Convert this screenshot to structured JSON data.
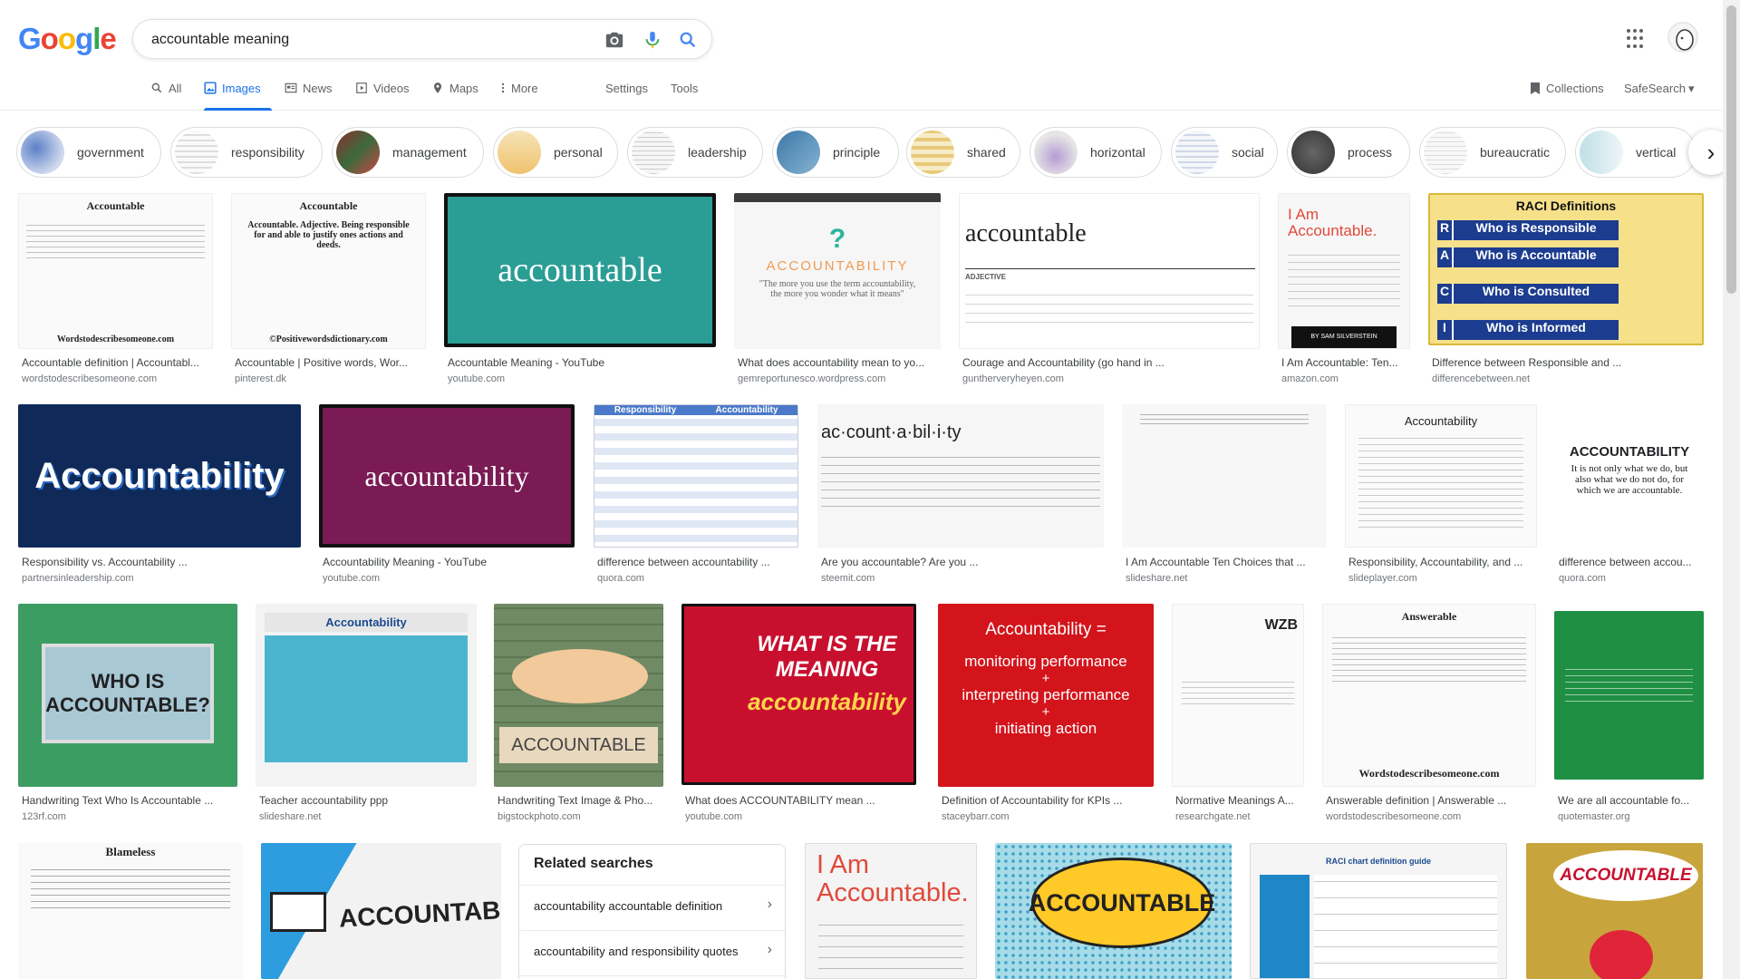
{
  "logo": [
    "G",
    "o",
    "o",
    "g",
    "l",
    "e"
  ],
  "search": {
    "value": "accountable meaning"
  },
  "tabs": [
    {
      "label": "All",
      "icon": "search-icon"
    },
    {
      "label": "Images",
      "icon": "image-icon"
    },
    {
      "label": "News",
      "icon": "news-icon"
    },
    {
      "label": "Videos",
      "icon": "video-icon"
    },
    {
      "label": "Maps",
      "icon": "map-icon"
    },
    {
      "label": "More",
      "icon": "more-vert-icon"
    }
  ],
  "tools": {
    "settings": "Settings",
    "tools": "Tools",
    "collections": "Collections",
    "safesearch": "SafeSearch"
  },
  "chips": [
    "government",
    "responsibility",
    "management",
    "personal",
    "leadership",
    "principle",
    "shared",
    "horizontal",
    "social",
    "process",
    "bureaucratic",
    "vertical"
  ],
  "results": [
    {
      "caption": "Accountable definition | Accountabl...",
      "source": "wordstodescribesomeone.com",
      "img_title": "Accountable",
      "img_footer": "Wordstodescribesomeone.com"
    },
    {
      "caption": "Accountable | Positive words, Wor...",
      "source": "pinterest.dk",
      "img_title": "Accountable",
      "img_body": "Accountable. Adjective. Being responsible for and able to justify ones actions and deeds.",
      "img_footer": "©Positivewordsdictionary.com"
    },
    {
      "caption": "Accountable Meaning - YouTube",
      "source": "youtube.com",
      "img_text": "accountable"
    },
    {
      "caption": "What does accountability mean to yo...",
      "source": "gemreportunesco.wordpress.com",
      "img_text": "ACCOUNTABILITY",
      "img_quote": "\"The more you use the term accountability, the more you wonder what it means\""
    },
    {
      "caption": "Courage and Accountability (go hand in ...",
      "source": "guntherveryheyen.com",
      "img_text": "accountable",
      "img_sub": "ADJECTIVE"
    },
    {
      "caption": "I Am Accountable: Ten...",
      "source": "amazon.com",
      "img_text": "I Am Accountable.",
      "img_author": "BY SAM SILVERSTEIN"
    },
    {
      "caption": "Difference between Responsible and ...",
      "source": "differencebetween.net",
      "img_title": "RACI Definitions",
      "raci": [
        {
          "k": "R",
          "v": "Who is Responsible"
        },
        {
          "k": "A",
          "v": "Who is Accountable"
        },
        {
          "k": "C",
          "v": "Who is Consulted"
        },
        {
          "k": "I",
          "v": "Who is Informed"
        }
      ]
    },
    {
      "caption": "Responsibility vs. Accountability ...",
      "source": "partnersinleadership.com",
      "img_text": "Accountability"
    },
    {
      "caption": "Accountability Meaning - YouTube",
      "source": "youtube.com",
      "img_text": "accountability"
    },
    {
      "caption": "difference between accountability ...",
      "source": "quora.com",
      "img_cols": [
        "Responsibility",
        "Accountability"
      ]
    },
    {
      "caption": "Are you accountable? Are you ...",
      "source": "steemit.com",
      "img_text": "ac·count·a·bil·i·ty"
    },
    {
      "caption": "I Am Accountable Ten Choices that ...",
      "source": "slideshare.net"
    },
    {
      "caption": "Responsibility, Accountability, and ...",
      "source": "slideplayer.com",
      "img_title": "Accountability"
    },
    {
      "caption": "difference between accou...",
      "source": "quora.com",
      "img_text": "ACCOUNTABILITY",
      "img_body": "It is not only what we do, but also what we do not do, for which we are accountable."
    },
    {
      "caption": "Handwriting Text Who Is Accountable ...",
      "source": "123rf.com",
      "img_text": "WHO IS ACCOUNTABLE?"
    },
    {
      "caption": "Teacher accountability ppp",
      "source": "slideshare.net",
      "img_title": "Accountability"
    },
    {
      "caption": "Handwriting Text Image & Pho...",
      "source": "bigstockphoto.com",
      "img_text": "ACCOUNTABLE"
    },
    {
      "caption": "What does ACCOUNTABILITY mean ...",
      "source": "youtube.com",
      "img_text": "WHAT IS THE MEANING",
      "img_sub": "accountability"
    },
    {
      "caption": "Definition of Accountability for KPIs ...",
      "source": "staceybarr.com",
      "img_lines": [
        "Accountability =",
        "monitoring performance",
        "+",
        "interpreting performance",
        "+",
        "initiating action"
      ]
    },
    {
      "caption": "Normative Meanings A...",
      "source": "researchgate.net",
      "img_text": "WZB"
    },
    {
      "caption": "Answerable definition | Answerable ...",
      "source": "wordstodescribesomeone.com",
      "img_title": "Answerable",
      "img_footer": "Wordstodescribesomeone.com"
    },
    {
      "caption": "We are all accountable fo...",
      "source": "quotemaster.org"
    },
    {
      "img_title": "Blameless"
    },
    {
      "img_text": "ACCOUNTABLE"
    },
    {
      "img_text": "I Am Accountable."
    },
    {
      "img_text": "ACCOUNTABLE"
    },
    {
      "img_title": "RACI chart definition guide"
    },
    {
      "img_text": "ACCOUNTABLE"
    }
  ],
  "related": {
    "title": "Related searches",
    "items": [
      "accountability accountable definition",
      "accountability and responsibility quotes"
    ]
  }
}
